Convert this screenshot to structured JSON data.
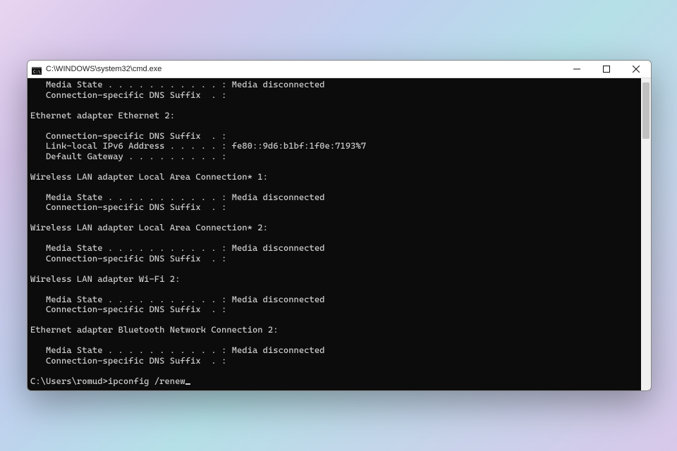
{
  "window": {
    "title": "C:\\WINDOWS\\system32\\cmd.exe"
  },
  "output": {
    "lines": [
      "   Media State . . . . . . . . . . . : Media disconnected",
      "   Connection-specific DNS Suffix  . :",
      "",
      "Ethernet adapter Ethernet 2:",
      "",
      "   Connection-specific DNS Suffix  . :",
      "   Link-local IPv6 Address . . . . . : fe80::9d6:b1bf:1f0e:7193%7",
      "   Default Gateway . . . . . . . . . :",
      "",
      "Wireless LAN adapter Local Area Connection* 1:",
      "",
      "   Media State . . . . . . . . . . . : Media disconnected",
      "   Connection-specific DNS Suffix  . :",
      "",
      "Wireless LAN adapter Local Area Connection* 2:",
      "",
      "   Media State . . . . . . . . . . . : Media disconnected",
      "   Connection-specific DNS Suffix  . :",
      "",
      "Wireless LAN adapter Wi-Fi 2:",
      "",
      "   Media State . . . . . . . . . . . : Media disconnected",
      "   Connection-specific DNS Suffix  . :",
      "",
      "Ethernet adapter Bluetooth Network Connection 2:",
      "",
      "   Media State . . . . . . . . . . . : Media disconnected",
      "   Connection-specific DNS Suffix  . :",
      ""
    ]
  },
  "prompt": {
    "path": "C:\\Users\\romud>",
    "command": "ipconfig /renew"
  }
}
